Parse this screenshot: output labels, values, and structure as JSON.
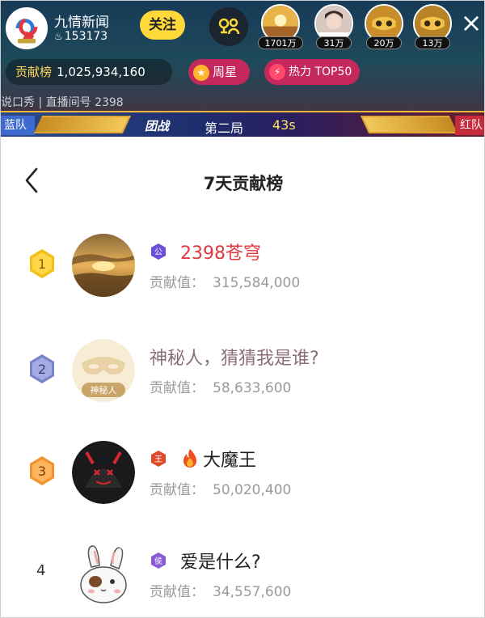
{
  "live_header": {
    "anchor_name": "九情新闻",
    "anchor_fans": "153173",
    "follow_label": "关注",
    "viewers": [
      {
        "label": "1701万"
      },
      {
        "label": "31万"
      },
      {
        "label": "20万"
      },
      {
        "label": "13万"
      }
    ],
    "close_symbol": "×",
    "contribution_key": "贡献榜",
    "contribution_value": "1,025,934,160",
    "week_star_label": "周星",
    "hot_label": "热力 TOP50",
    "room_info": "说口秀 | 直播间号 2398",
    "pk": {
      "blue_team": "蓝队",
      "red_team": "红队",
      "mode": "团战",
      "round": "第二局",
      "timer": "43s"
    }
  },
  "panel": {
    "back_symbol": "<",
    "title": "7天贡献榜",
    "contribution_label": "贡献值：",
    "items": [
      {
        "rank": "1",
        "level_icon": "公",
        "name": "2398苍穹",
        "name_color": "#e0383e",
        "contribution": "315,584,000",
        "badge_color": "#f0c020",
        "avatar": "sunset-avatar",
        "has_flame": false
      },
      {
        "rank": "2",
        "level_icon": "",
        "name": "神秘人，猜猜我是谁?",
        "name_color": "#8b6e78",
        "contribution": "58,633,600",
        "badge_color": "#7b83c9",
        "avatar": "mystery-mask-avatar",
        "avatar_text": "神秘人",
        "has_flame": false
      },
      {
        "rank": "3",
        "level_icon": "王",
        "name": "大魔王",
        "name_color": "#222222",
        "contribution": "50,020,400",
        "badge_color": "#f39a3b",
        "avatar": "demon-avatar",
        "has_flame": true
      },
      {
        "rank": "4",
        "level_icon": "侯",
        "name": "爱是什么?",
        "name_color": "#222222",
        "contribution": "34,557,600",
        "badge_color": "",
        "avatar": "bunny-avatar",
        "has_flame": false
      }
    ]
  }
}
